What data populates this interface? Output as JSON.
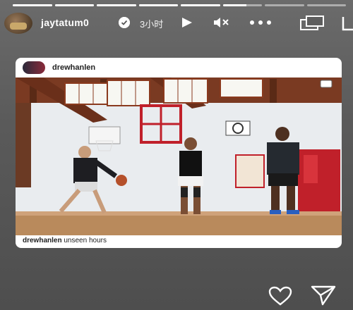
{
  "story": {
    "progress": [
      1,
      1,
      1,
      1,
      1,
      0.6,
      0,
      0
    ],
    "username": "jaytatum0",
    "time_ago": "3小时",
    "icons": {
      "verified": "verified-badge-icon",
      "play": "play-icon",
      "mute": "mute-icon",
      "more": "more-options-icon",
      "window": "picture-in-picture-icon",
      "edge": "close-icon"
    }
  },
  "card": {
    "username": "drewhanlen",
    "caption_user": "drewhanlen",
    "caption_text": "unseen hours"
  },
  "footer": {
    "icons": {
      "like": "heart-icon",
      "share": "send-icon"
    }
  }
}
